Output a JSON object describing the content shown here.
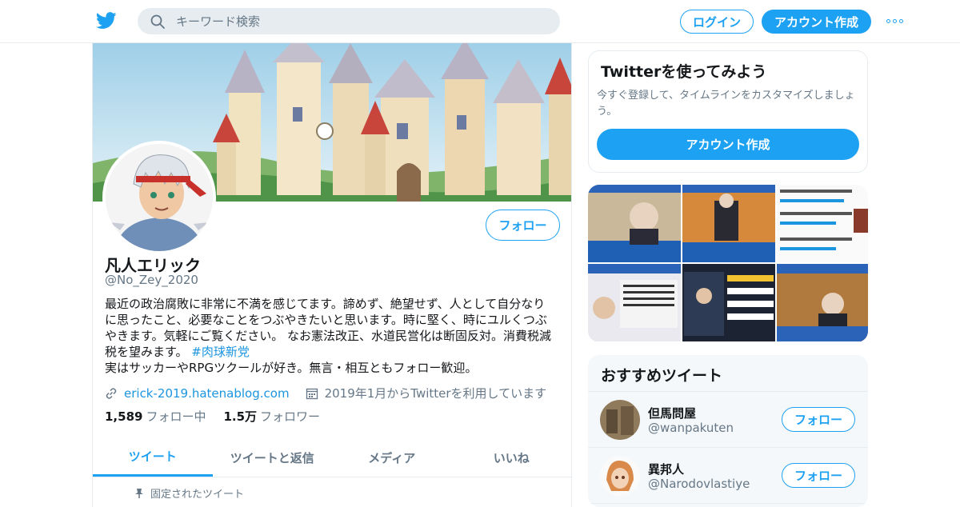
{
  "header": {
    "search_placeholder": "キーワード検索",
    "login_label": "ログイン",
    "signup_label": "アカウント作成"
  },
  "profile": {
    "follow_label": "フォロー",
    "name": "凡人エリック",
    "handle": "@No_Zey_2020",
    "bio_line1": "最近の政治腐敗に非常に不満を感じてます。諦めず、絶望せず、人として自分なり",
    "bio_line2": "に思ったこと、必要なことをつぶやきたいと思います。時に堅く、時にユルくつぶ",
    "bio_line3": "やきます。気軽にご覧ください。 なお憲法改正、水道民営化は断固反対。消費税減",
    "bio_line4": "税を望みます。",
    "bio_hashtag": "#肉球新党",
    "bio_line5": "実はサッカーやRPGツクールが好き。無言・相互ともフォロー歓迎。",
    "website": "erick-2019.hatenablog.com",
    "joined": "2019年1月からTwitterを利用しています",
    "following_count": "1,589",
    "following_label": "フォロー中",
    "followers_count": "1.5万",
    "followers_label": "フォロワー",
    "tabs": [
      "ツイート",
      "ツイートと返信",
      "メディア",
      "いいね"
    ],
    "pinned_label": "固定されたツイート"
  },
  "signup_card": {
    "title": "Twitterを使ってみよう",
    "description": "今すぐ登録して、タイムラインをカスタマイズしましょう。",
    "button_label": "アカウント作成"
  },
  "recommended": {
    "title": "おすすめツイート",
    "accounts": [
      {
        "name": "但馬問屋",
        "handle": "@wanpakuten",
        "follow_label": "フォロー"
      },
      {
        "name": "異邦人",
        "handle": "@Narodovlastiye",
        "follow_label": "フォロー"
      }
    ]
  },
  "colors": {
    "accent": "#1da1f2",
    "border": "#e6ecf0",
    "secondary_text": "#657786"
  }
}
